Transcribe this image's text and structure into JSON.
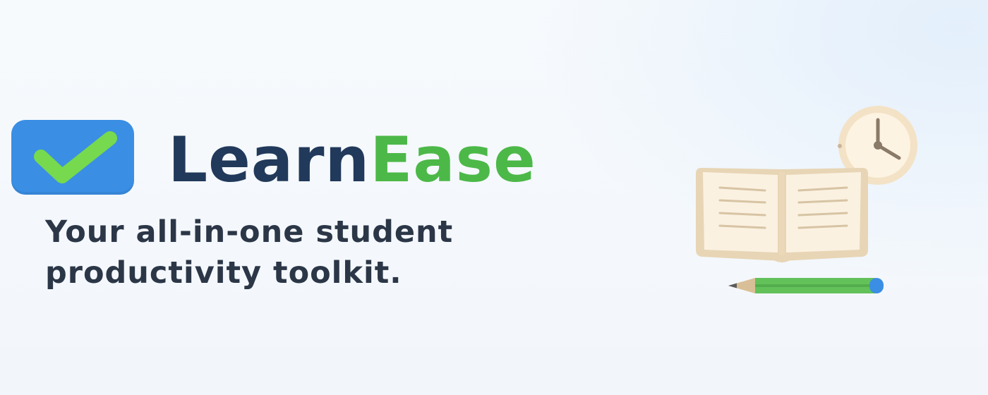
{
  "brand": {
    "name_part1": "Learn",
    "name_part2": "Ease",
    "color_primary": "#21395a",
    "color_accent": "#4cb848",
    "logo_tile_color": "#3a8ee4",
    "logo_icon": "checkmark-icon"
  },
  "tagline": {
    "line1": "Your all-in-one student",
    "line2": "productivity toolkit."
  },
  "illustration": {
    "icons": [
      "open-book-icon",
      "clock-icon",
      "pencil-icon"
    ]
  }
}
